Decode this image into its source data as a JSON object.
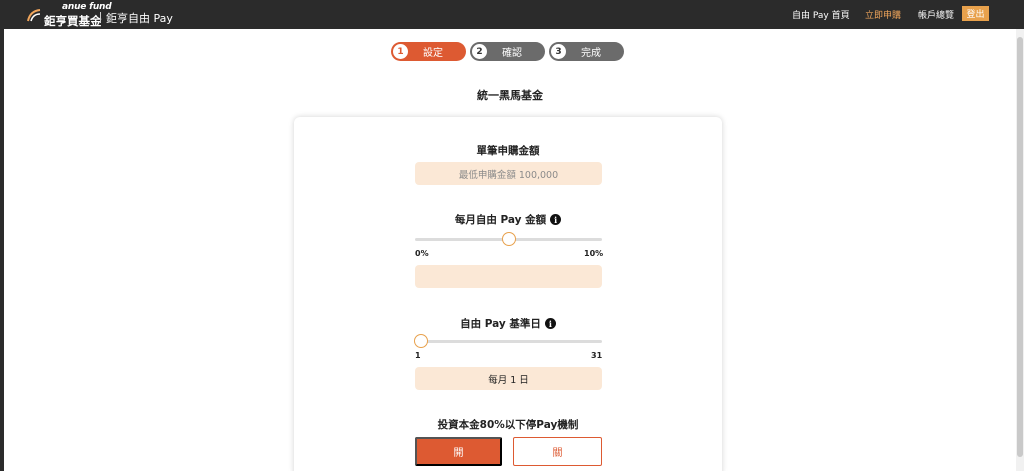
{
  "header": {
    "brand_sub": "anue fund",
    "brand_main": "鉅亨買基金",
    "product": "鉅亨自由 Pay",
    "nav": {
      "home": "自由 Pay 首頁",
      "apply": "立即申購",
      "account": "帳戶總覽",
      "logout": "登出"
    }
  },
  "steps": [
    {
      "num": "1",
      "label": "設定"
    },
    {
      "num": "2",
      "label": "確認"
    },
    {
      "num": "3",
      "label": "完成"
    }
  ],
  "fund_name": "統一黑馬基金",
  "form": {
    "single_amount": {
      "title": "單筆申購金額",
      "placeholder": "最低申購金額 100,000"
    },
    "monthly_pay": {
      "title": "每月自由 Pay 金額",
      "min_label": "0%",
      "max_label": "10%",
      "value_fraction": 0.5,
      "value": ""
    },
    "base_day": {
      "title": "自由 Pay 基準日",
      "min_label": "1",
      "max_label": "31",
      "value_day": 1,
      "value": "每月 1 日"
    },
    "stop_mechanism": {
      "title": "投資本金80%以下停Pay機制",
      "on_label": "開",
      "off_label": "關",
      "selected": "開"
    }
  },
  "colors": {
    "accent": "#dd5a32",
    "nav_highlight": "#f0a55b",
    "logout_bg": "#e8a14c",
    "field_bg": "#fbe8d6",
    "step_inactive": "#6b6b6b"
  }
}
